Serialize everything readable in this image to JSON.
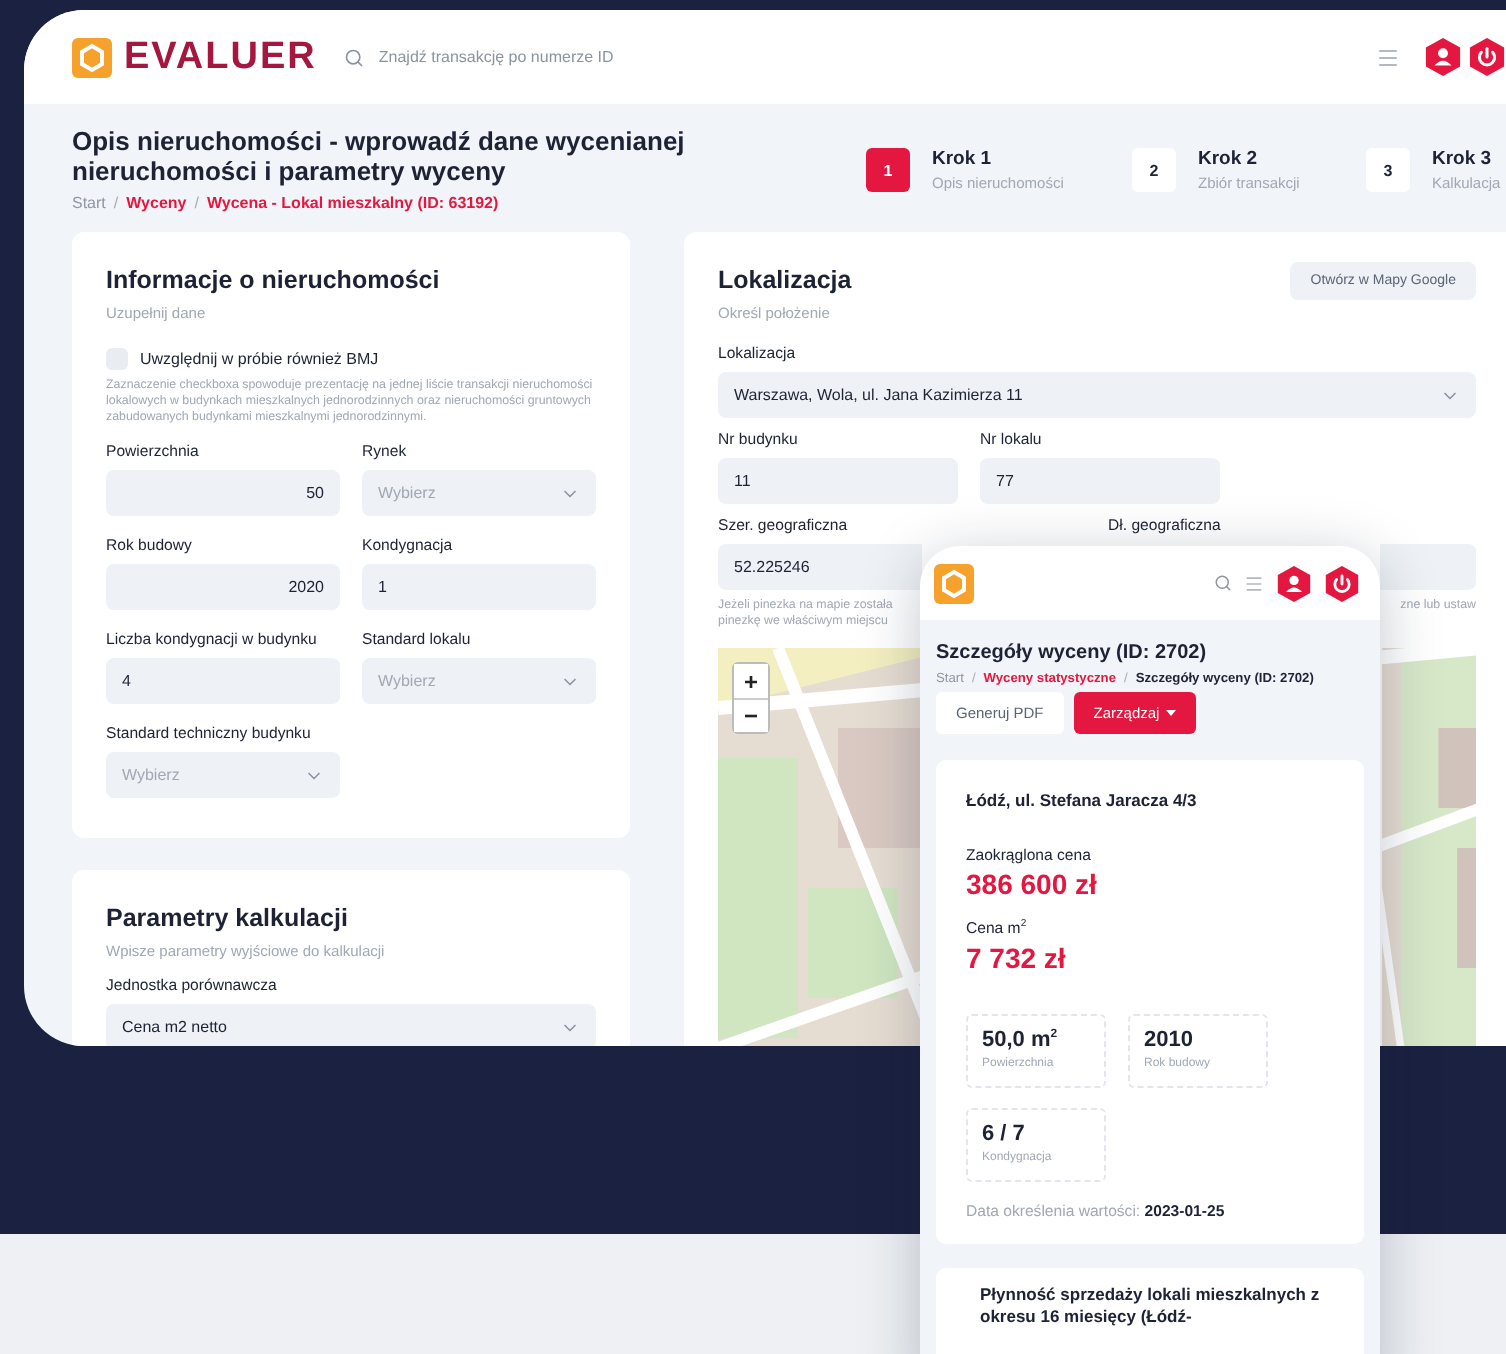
{
  "header": {
    "logo_text": "EVALUER",
    "search_placeholder": "Znajdź transakcję po numerze ID"
  },
  "page": {
    "title": "Opis nieruchomości - wprowadź dane wycenianej nieruchomości i parametry wyceny",
    "breadcrumb": [
      {
        "label": "Start",
        "link": false
      },
      {
        "separator": "/",
        "label": "Wyceny",
        "link": true
      },
      {
        "separator": "/",
        "label": "Wycena - Lokal mieszkalny (ID: 63192)",
        "link": true
      }
    ]
  },
  "steps": [
    {
      "number": "1",
      "title": "Krok 1",
      "subtitle": "Opis nieruchomości",
      "selected": true
    },
    {
      "number": "2",
      "title": "Krok 2",
      "subtitle": "Zbiór transakcji",
      "selected": false
    },
    {
      "number": "3",
      "title": "Krok 3",
      "subtitle": "Kalkulacja",
      "selected": false
    }
  ],
  "property_card": {
    "title": "Informacje o nieruchomości",
    "subtitle": "Uzupełnij dane",
    "checkbox": {
      "label": "Uwzględnij w próbie również BMJ",
      "checked": false
    },
    "hint": "Zaznaczenie checkboxa spowoduje prezentację na jednej liście transakcji nieruchomości lokalowych w budynkach mieszkalnych jednorodzinnych oraz nieruchomości gruntowych zabudowanych budynkami mieszkalnymi jednorodzinnymi.",
    "fields": [
      {
        "label": "Powierzchnia",
        "kind": "number",
        "value": "50"
      },
      {
        "label": "Rynek",
        "kind": "select",
        "placeholder": "Wybierz"
      },
      {
        "label": "Rok budowy",
        "kind": "number",
        "value": "2020"
      },
      {
        "label": "Kondygnacja",
        "kind": "text",
        "value": "1"
      },
      {
        "label": "Liczba kondygnacji w budynku",
        "kind": "text",
        "value": "4"
      },
      {
        "label": "Standard lokalu",
        "kind": "select",
        "placeholder": "Wybierz"
      },
      {
        "label": "Standard techniczny budynku",
        "kind": "select",
        "placeholder": "Wybierz"
      }
    ]
  },
  "calc_card": {
    "title": "Parametry kalkulacji",
    "subtitle": "Wpisze parametry wyjściowe do kalkulacji",
    "fields": [
      {
        "label": "Jednostka porównawcza",
        "kind": "select",
        "value": "Cena m2 netto"
      }
    ]
  },
  "location_card": {
    "title": "Lokalizacja",
    "subtitle": "Określ położenie",
    "button": "Otwórz w Mapy Google",
    "rows": [
      [
        {
          "label": "Lokalizacja",
          "kind": "select",
          "value": "Warszawa, Wola, ul. Jana Kazimierza 11"
        }
      ],
      [
        {
          "label": "Nr budynku",
          "kind": "text",
          "value": "11"
        },
        {
          "label": "Nr lokalu",
          "kind": "text",
          "value": "77"
        }
      ],
      [
        {
          "label": "Szer. geograficzna",
          "kind": "text",
          "value": "52.225246"
        },
        {
          "label": "Dł. geograficzna",
          "kind": "text"
        }
      ]
    ],
    "hint_left": [
      "Jeżeli pinezka na mapie została",
      "pinezkę we właściwym miejscu"
    ],
    "hint_right": "zne lub ustaw",
    "map": {
      "zoom_in": "+",
      "zoom_out": "−"
    }
  },
  "mobile": {
    "title": "Szczegóły wyceny (ID: 2702)",
    "breadcrumb": [
      {
        "label": "Start",
        "link": false
      },
      {
        "separator": "/",
        "label": "Wyceny statystyczne",
        "link": true
      },
      {
        "separator": "/",
        "label": "Szczegóły wyceny (ID: 2702)",
        "link": false
      }
    ],
    "buttons": [
      {
        "label": "Generuj PDF",
        "kind": "secondary"
      },
      {
        "label": "Zarządzaj",
        "kind": "dropdown"
      }
    ],
    "address": "Łódź, ul. Stefana Jaracza 4/3",
    "prices": [
      {
        "label": "Zaokrąglona cena",
        "value": "386 600 zł"
      },
      {
        "label": "Cena m$^{2}$",
        "value": "7 732 zł"
      }
    ],
    "tiles": [
      {
        "value": "50,0 m$^{2}$",
        "label": "Powierzchnia"
      },
      {
        "value": "2010",
        "label": "Rok budowy"
      },
      {
        "value": "6 / 7",
        "label": "Kondygnacja"
      }
    ],
    "date_label": "Data określenia wartości:",
    "date_value": "2023-01-25",
    "next_card_title": "Płynność sprzedaży lokali mieszkalnych z okresu 16 miesięcy (Łódź-"
  }
}
